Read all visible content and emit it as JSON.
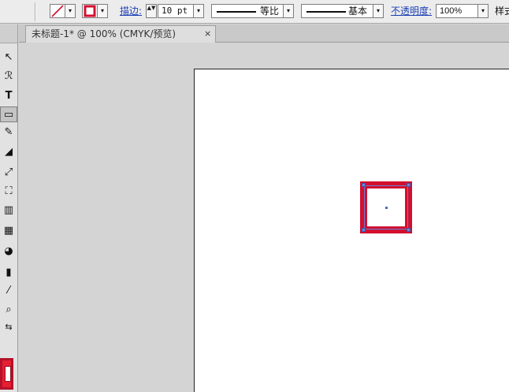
{
  "control_bar": {
    "stroke_label": "描边:",
    "stroke_weight_value": "10 pt",
    "profile_label": "等比",
    "brush_label": "基本",
    "opacity_label": "不透明度:",
    "opacity_value": "100%",
    "style_label_truncated": "样式",
    "dropdown_glyph": "▾",
    "spinner_glyph": "▲▼",
    "fill_swatch_color": "none",
    "stroke_swatch_color": "#d2102f"
  },
  "document_tab": {
    "title": "未标题-1* @ 100% (CMYK/预览)",
    "close_glyph": "×"
  },
  "toolbox": {
    "tools": [
      {
        "name": "direct-selection-tool",
        "glyph": "↖"
      },
      {
        "name": "lasso-tool",
        "glyph": "ℛ"
      },
      {
        "name": "type-tool",
        "glyph": "T"
      },
      {
        "name": "rectangle-tool",
        "glyph": "▭"
      },
      {
        "name": "pencil-tool",
        "glyph": "✎"
      },
      {
        "name": "eraser-tool",
        "glyph": "◢"
      },
      {
        "name": "scale-tool",
        "glyph": "⤢"
      },
      {
        "name": "free-transform-tool",
        "glyph": "⛶"
      },
      {
        "name": "symbol-sprayer-tool",
        "glyph": "▥"
      },
      {
        "name": "gradient-tool",
        "glyph": "▦"
      },
      {
        "name": "blend-tool",
        "glyph": "◕"
      },
      {
        "name": "column-graph-tool",
        "glyph": "▮"
      },
      {
        "name": "eyedropper-tool",
        "glyph": "⁄"
      },
      {
        "name": "zoom-tool",
        "glyph": "⌕"
      },
      {
        "name": "swap-fill-stroke",
        "glyph": "⇆"
      }
    ],
    "fill_color": "#ffffff",
    "stroke_color": "#e61e34"
  },
  "artwork": {
    "shape": "rectangle",
    "fill_color": "#ffffff",
    "stroke_color": "#d2102f",
    "stroke_weight": "10 pt",
    "selected": true
  }
}
